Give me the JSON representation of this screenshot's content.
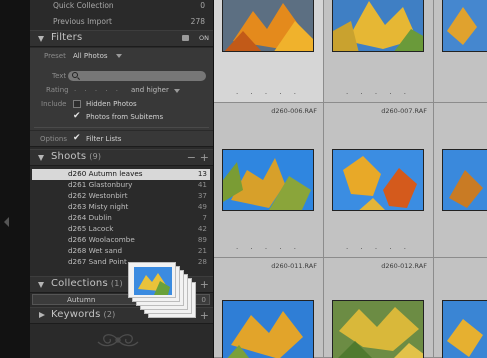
{
  "library": {
    "top_items": [
      {
        "label": "Quick Collection",
        "count": "0"
      },
      {
        "label": "Previous Import",
        "count": "278"
      }
    ]
  },
  "filters": {
    "title": "Filters",
    "toggle_label": "ON",
    "preset_label": "Preset",
    "preset_value": "All Photos",
    "text_label": "Text",
    "rating_label": "Rating",
    "rating_dots": "· · · · ·",
    "rating_condition": "and higher",
    "include_label": "Include",
    "hidden_photos_label": "Hidden Photos",
    "subitems_label": "Photos from Subitems",
    "options_label": "Options",
    "filter_lists_label": "Filter Lists"
  },
  "shoots": {
    "title": "Shoots",
    "count": "(9)",
    "items": [
      {
        "name": "d260 Autumn leaves",
        "count": "13"
      },
      {
        "name": "d261 Glastonbury",
        "count": "41"
      },
      {
        "name": "d262 Westonbirt",
        "count": "37"
      },
      {
        "name": "d263 Misty night",
        "count": "49"
      },
      {
        "name": "d264 Dublin",
        "count": "7"
      },
      {
        "name": "d265 Lacock",
        "count": "42"
      },
      {
        "name": "d266 Woolacombe",
        "count": "89"
      },
      {
        "name": "d268 Wet sand",
        "count": "21"
      },
      {
        "name": "d267 Sand Point",
        "count": "28"
      }
    ]
  },
  "collections": {
    "title": "Collections",
    "count": "(1)",
    "items": [
      {
        "name": "Autumn",
        "count": "0"
      }
    ]
  },
  "keywords": {
    "title": "Keywords",
    "count": "(2)"
  },
  "grid": {
    "cells": [
      {
        "filename": "",
        "dots": ". . . . ."
      },
      {
        "filename": "",
        "dots": ". . . . ."
      },
      {
        "filename": "",
        "dots": ""
      },
      {
        "filename": "d260-006.RAF",
        "dots": ". . . . ."
      },
      {
        "filename": "d260-007.RAF",
        "dots": ". . . . ."
      },
      {
        "filename": "",
        "dots": ""
      },
      {
        "filename": "d260-011.RAF",
        "dots": ""
      },
      {
        "filename": "d260-012.RAF",
        "dots": ""
      },
      {
        "filename": "",
        "dots": ""
      }
    ]
  }
}
